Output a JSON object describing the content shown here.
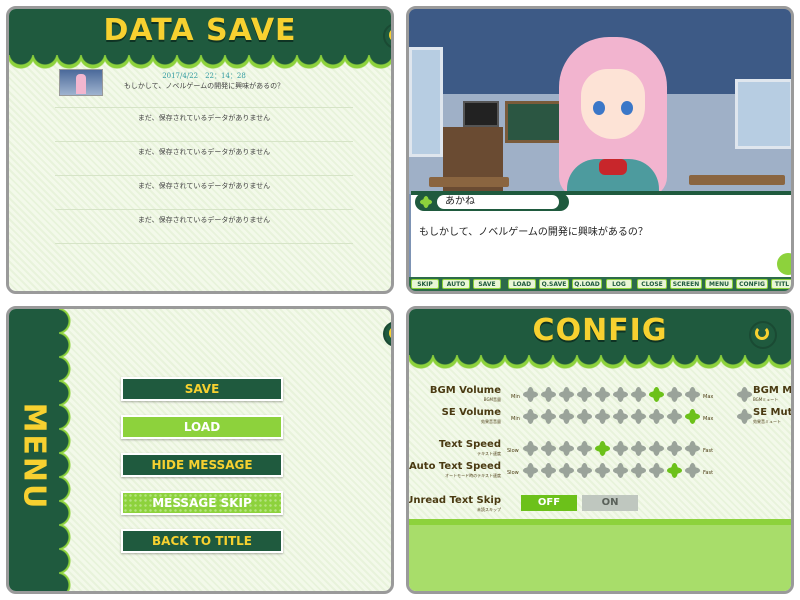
{
  "save_screen": {
    "title": "DATA SAVE",
    "slots": [
      {
        "date": "2017/4/22　22：14：28",
        "text": "もしかして、ノベルゲームの開発に興味があるの？"
      },
      {
        "text": "まだ、保存されているデータがありません"
      },
      {
        "text": "まだ、保存されているデータがありません"
      },
      {
        "text": "まだ、保存されているデータがありません"
      },
      {
        "text": "まだ、保存されているデータがありません"
      }
    ]
  },
  "game_screen": {
    "speaker_name": "あかね",
    "dialog_text": "もしかして、ノベルゲームの開発に興味があるの？",
    "toolbar": [
      "SKIP",
      "AUTO",
      "SAVE",
      "LOAD",
      "Q.SAVE",
      "Q.LOAD",
      "LOG",
      "CLOSE",
      "SCREEN",
      "MENU",
      "CONFIG",
      "TITL"
    ]
  },
  "menu_screen": {
    "title": "MENU",
    "buttons": [
      "SAVE",
      "LOAD",
      "HIDE MESSAGE",
      "MESSAGE SKIP",
      "BACK TO TITLE"
    ]
  },
  "config_screen": {
    "title": "CONFIG",
    "bgm_volume": {
      "label": "BGM Volume",
      "sub": "BGM音量",
      "min": "Min",
      "max": "Max",
      "level": 8,
      "steps": 10
    },
    "se_volume": {
      "label": "SE Volume",
      "sub": "効果音音量",
      "min": "Min",
      "max": "Max",
      "level": 10,
      "steps": 10
    },
    "text_speed": {
      "label": "Text Speed",
      "sub": "テキスト速度",
      "min": "Slow",
      "max": "Fast",
      "level": 5,
      "steps": 10
    },
    "auto_text_speed": {
      "label": "Auto Text Speed",
      "sub": "オートモード時のテキスト速度",
      "min": "Slow",
      "max": "Fast",
      "level": 9,
      "steps": 10
    },
    "bgm_mute": {
      "label": "BGM Mut",
      "sub": "BGMミュート"
    },
    "se_mute": {
      "label": "SE Mute",
      "sub": "効果音ミュート"
    },
    "unread_skip": {
      "label": "Unread Text Skip",
      "sub": "未読スキップ",
      "off": "OFF",
      "on": "ON",
      "selected": "OFF"
    }
  },
  "colors": {
    "dark_green": "#1f5a3e",
    "light_green": "#8dd23c",
    "yellow": "#f7d130"
  }
}
